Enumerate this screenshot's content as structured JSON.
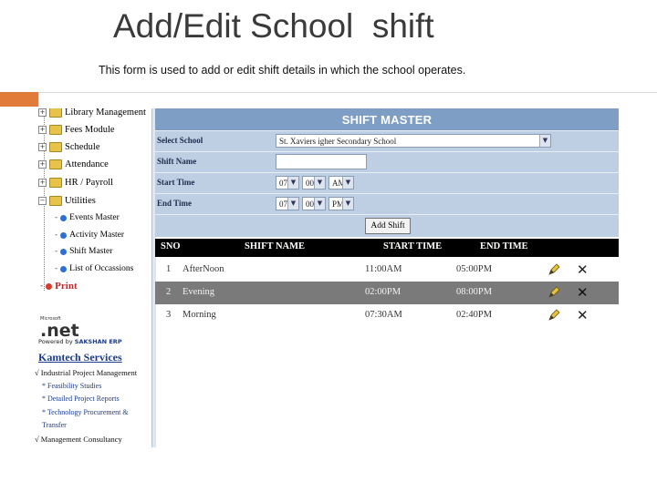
{
  "slide": {
    "title": "Add/Edit School  shift",
    "subtitle": "This form is used to add or edit shift details in which the school operates."
  },
  "colors": {
    "accent": "#e07b39",
    "form_header": "#7e9ec6",
    "form_row": "#bfcfe3",
    "grid_header": "#000000",
    "grid_alt": "#7a7a7a"
  },
  "sidebar": {
    "tree": [
      {
        "label": "Library Management",
        "icon": "folder-icon"
      },
      {
        "label": "Fees Module",
        "icon": "folder-icon"
      },
      {
        "label": "Schedule",
        "icon": "folder-icon"
      },
      {
        "label": "Attendance",
        "icon": "folder-icon"
      },
      {
        "label": "HR / Payroll",
        "icon": "folder-icon"
      },
      {
        "label": "Utilities",
        "icon": "folder-icon"
      }
    ],
    "utilities": [
      {
        "label": "Events Master"
      },
      {
        "label": "Activity Master"
      },
      {
        "label": "Shift Master"
      },
      {
        "label": "List of Occassions"
      }
    ],
    "print": "Print",
    "net_ms": "Microsoft",
    "net_label": ".net",
    "powered_by": "Powered by",
    "powered_brand": "SAKSHAN ERP",
    "company": "Kamtech Services",
    "services": [
      "√ Industrial Project Management",
      "* Feasibility Studies",
      "* Detailed Project Reports",
      "* Technology Procurement &",
      "Transfer",
      "√ Management Consultancy"
    ]
  },
  "form": {
    "header": "SHIFT MASTER",
    "select_school_label": "Select School",
    "school_value": "St. Xaviers  igher Secondary School",
    "shift_name_label": "Shift Name",
    "shift_name_value": "",
    "start_time_label": "Start Time",
    "start_hour": "07",
    "start_min": "00",
    "start_ampm": "AM",
    "end_time_label": "End Time",
    "end_hour": "07",
    "end_min": "00",
    "end_ampm": "PM",
    "add_button": "Add Shift"
  },
  "grid": {
    "columns": [
      "SNO",
      "SHIFT NAME",
      "START TIME",
      "END TIME"
    ],
    "rows": [
      {
        "sno": "1",
        "name": "AfterNoon",
        "start": "11:00AM",
        "end": "05:00PM"
      },
      {
        "sno": "2",
        "name": "Evening",
        "start": "02:00PM",
        "end": "08:00PM"
      },
      {
        "sno": "3",
        "name": "Morning",
        "start": "07:30AM",
        "end": "02:40PM"
      }
    ]
  }
}
